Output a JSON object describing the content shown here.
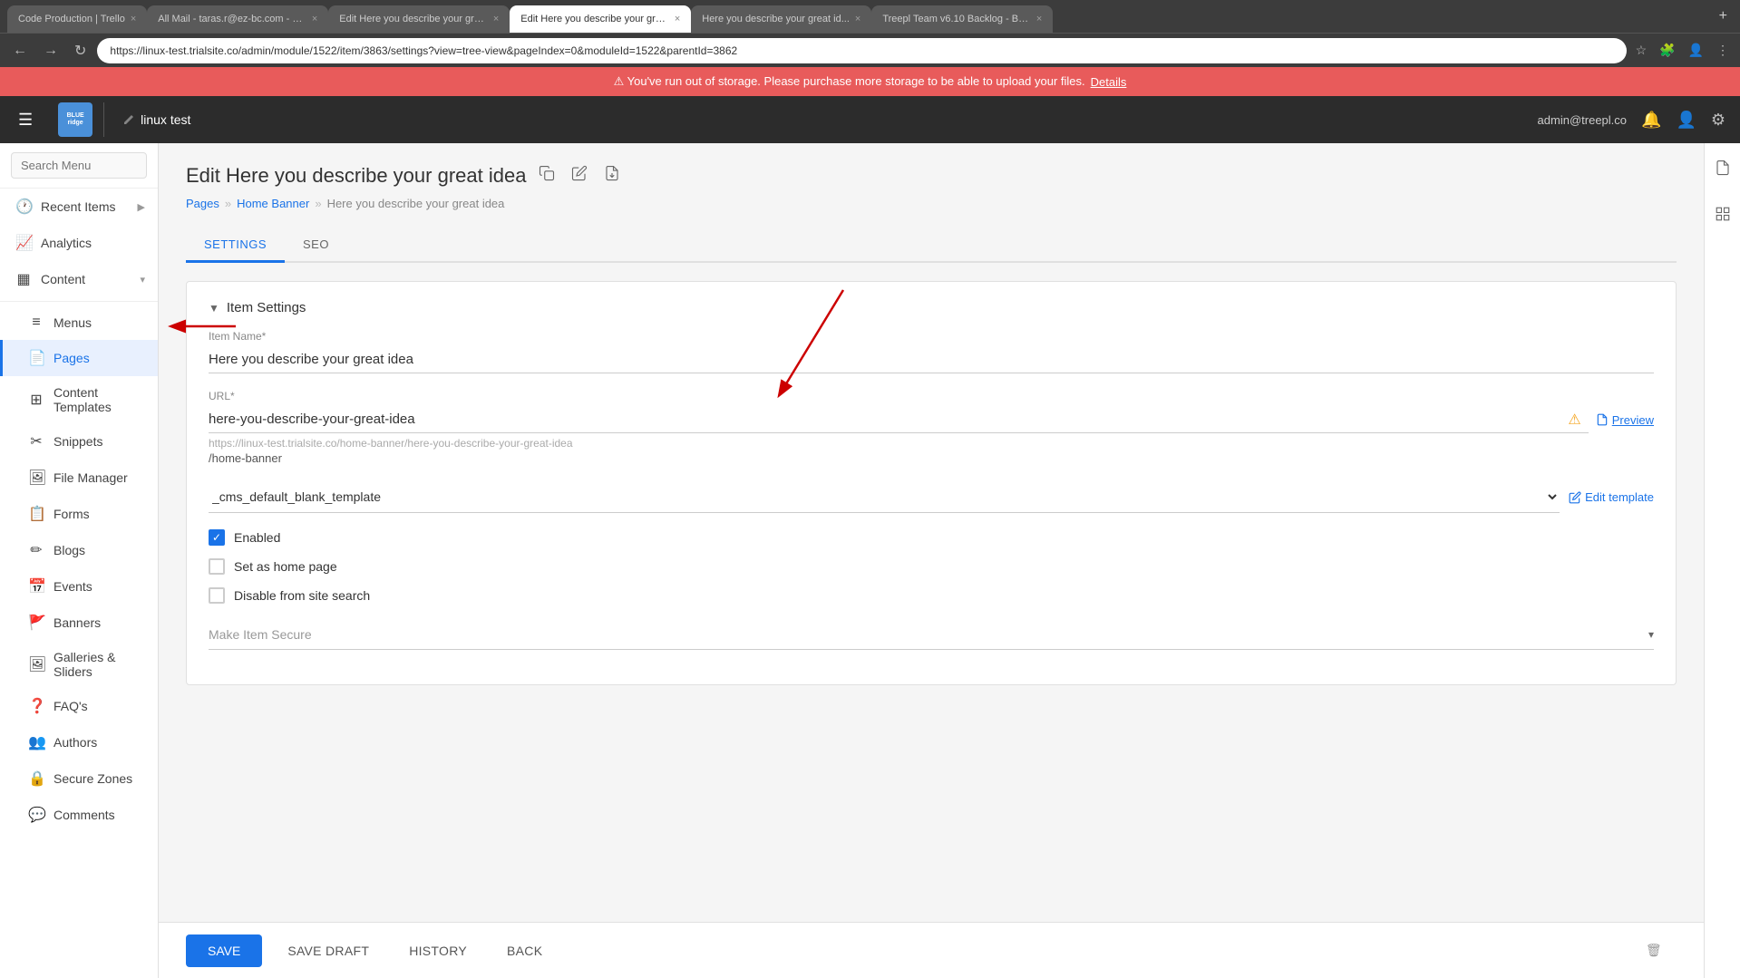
{
  "browser": {
    "tabs": [
      {
        "id": "tab1",
        "title": "Code Production | Trello",
        "icon": "trello",
        "active": false
      },
      {
        "id": "tab2",
        "title": "All Mail - taras.r@ez-bc.com - E...",
        "icon": "gmail",
        "active": false
      },
      {
        "id": "tab3",
        "title": "Edit Here you describe your gre...",
        "icon": "edit",
        "active": false
      },
      {
        "id": "tab4",
        "title": "Edit Here you describe your gre...",
        "icon": "edit",
        "active": true
      },
      {
        "id": "tab5",
        "title": "Here you describe your great id...",
        "icon": "page",
        "active": false
      },
      {
        "id": "tab6",
        "title": "Treepl Team v6.10 Backlog - Boa...",
        "icon": "trello",
        "active": false
      }
    ],
    "address": "https://linux-test.trialsite.co/admin/module/1522/item/3863/settings?view=tree-view&pageIndex=0&moduleId=1522&parentId=3862"
  },
  "alert": {
    "message": "⚠ You've run out of storage. Please purchase more storage to be able to upload your files.",
    "link_text": "Details"
  },
  "topbar": {
    "site_name": "linux test",
    "logo_line1": "BLUE",
    "logo_line2": "ridge",
    "user": "admin@treepl.co"
  },
  "sidebar": {
    "search_placeholder": "Search Menu",
    "items": [
      {
        "id": "recent",
        "label": "Recent Items",
        "icon": "🕐",
        "has_arrow": true
      },
      {
        "id": "analytics",
        "label": "Analytics",
        "icon": "📈",
        "has_arrow": false
      },
      {
        "id": "content",
        "label": "Content",
        "icon": "▦",
        "has_arrow": true,
        "expanded": true
      },
      {
        "id": "menus",
        "label": "Menus",
        "icon": "≡",
        "sub": true
      },
      {
        "id": "pages",
        "label": "Pages",
        "icon": "📄",
        "sub": true,
        "active": true
      },
      {
        "id": "content-templates",
        "label": "Content Templates",
        "icon": "⊞",
        "sub": true
      },
      {
        "id": "snippets",
        "label": "Snippets",
        "icon": "✂",
        "sub": true
      },
      {
        "id": "file-manager",
        "label": "File Manager",
        "icon": "🖼",
        "sub": true
      },
      {
        "id": "forms",
        "label": "Forms",
        "icon": "📋",
        "sub": true
      },
      {
        "id": "blogs",
        "label": "Blogs",
        "icon": "✏",
        "sub": true
      },
      {
        "id": "events",
        "label": "Events",
        "icon": "📅",
        "sub": true
      },
      {
        "id": "banners",
        "label": "Banners",
        "icon": "🚩",
        "sub": true
      },
      {
        "id": "galleries",
        "label": "Galleries & Sliders",
        "icon": "🖼",
        "sub": true
      },
      {
        "id": "faqs",
        "label": "FAQ's",
        "icon": "❓",
        "sub": true
      },
      {
        "id": "authors",
        "label": "Authors",
        "icon": "👥",
        "sub": true
      },
      {
        "id": "secure-zones",
        "label": "Secure Zones",
        "icon": "🔒",
        "sub": true
      },
      {
        "id": "comments",
        "label": "Comments",
        "icon": "💬",
        "sub": true
      }
    ]
  },
  "page": {
    "title": "Edit Here you describe your great idea",
    "breadcrumbs": [
      {
        "label": "Pages",
        "href": "#"
      },
      {
        "label": "Home Banner",
        "href": "#"
      },
      {
        "label": "Here you describe your great idea",
        "href": null
      }
    ],
    "tabs": [
      {
        "id": "settings",
        "label": "SETTINGS",
        "active": true
      },
      {
        "id": "seo",
        "label": "SEO",
        "active": false
      }
    ]
  },
  "settings": {
    "section_title": "Item Settings",
    "item_name_label": "Item Name*",
    "item_name_value": "Here you describe your great idea",
    "url_label": "URL*",
    "url_value": "here-you-describe-your-great-idea",
    "url_full": "https://linux-test.trialsite.co/home-banner/here-you-describe-your-great-idea",
    "url_path": "/home-banner",
    "preview_label": "Preview",
    "template_value": "_cms_default_blank_template",
    "edit_template_label": "Edit template",
    "checkboxes": [
      {
        "id": "enabled",
        "label": "Enabled",
        "checked": true
      },
      {
        "id": "home-page",
        "label": "Set as home page",
        "checked": false
      },
      {
        "id": "disable-search",
        "label": "Disable from site search",
        "checked": false
      }
    ],
    "secure_label": "Make Item Secure",
    "secure_placeholder": "Make Item Secure"
  },
  "actions": {
    "save": "SAVE",
    "save_draft": "SAVE DRAFT",
    "history": "HISTORY",
    "back": "BACK"
  }
}
